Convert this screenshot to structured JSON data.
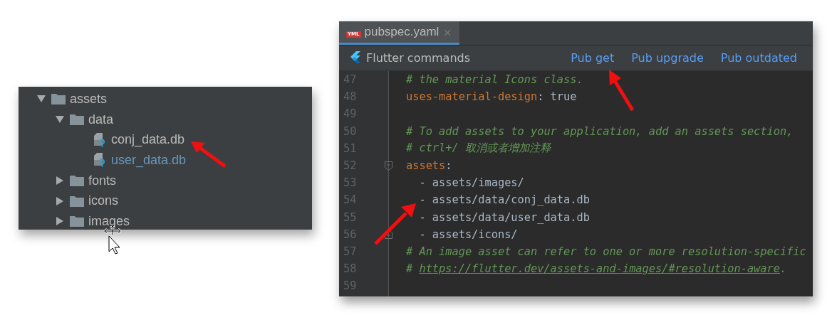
{
  "project_tree": [
    {
      "label": "assets",
      "kind": "folder",
      "expanded": true,
      "children": [
        {
          "label": "data",
          "kind": "folder",
          "expanded": true,
          "children": [
            {
              "label": "conj_data.db",
              "kind": "file",
              "color": "#bbbbbb"
            },
            {
              "label": "user_data.db",
              "kind": "file",
              "color": "#6897bb"
            }
          ]
        },
        {
          "label": "fonts",
          "kind": "folder",
          "expanded": false
        },
        {
          "label": "icons",
          "kind": "folder",
          "expanded": false
        },
        {
          "label": "images",
          "kind": "folder",
          "expanded": false
        }
      ]
    }
  ],
  "editor": {
    "tabs": [
      {
        "label": "pubspec.yaml",
        "icon_text": "YML",
        "close": "×",
        "selected": true
      }
    ],
    "commands_bar": {
      "title": "Flutter commands",
      "links": [
        "Pub get",
        "Pub upgrade",
        "Pub outdated"
      ]
    },
    "lines": [
      {
        "number": "47",
        "segments": [
          {
            "kind": "comment",
            "text": "# the material Icons class."
          }
        ]
      },
      {
        "number": "48",
        "segments": [
          {
            "kind": "key",
            "text": "uses-material-design"
          },
          {
            "kind": "plain",
            "text": ": true"
          }
        ]
      },
      {
        "number": "49"
      },
      {
        "number": "50",
        "segments": [
          {
            "kind": "comment",
            "text": "# To add assets to your application, add an assets section,"
          }
        ]
      },
      {
        "number": "51",
        "segments": [
          {
            "kind": "comment",
            "text": "# ctrl+/ 取消或者增加注释"
          }
        ]
      },
      {
        "number": "52",
        "fold_start": true,
        "segments": [
          {
            "kind": "key",
            "text": "assets"
          },
          {
            "kind": "plain",
            "text": ":"
          }
        ]
      },
      {
        "number": "53",
        "segments": [
          {
            "kind": "plain",
            "text": "  - assets/images/"
          }
        ]
      },
      {
        "number": "54",
        "segments": [
          {
            "kind": "plain",
            "text": "  - assets/data/conj_data.db"
          }
        ]
      },
      {
        "number": "55",
        "segments": [
          {
            "kind": "plain",
            "text": "  - assets/data/user_data.db"
          }
        ]
      },
      {
        "number": "56",
        "fold_end": true,
        "segments": [
          {
            "kind": "plain",
            "text": "  - assets/icons/"
          }
        ]
      },
      {
        "number": "57",
        "segments": [
          {
            "kind": "comment",
            "text": "# An image asset can refer to one or more resolution-specific"
          }
        ]
      },
      {
        "number": "58",
        "segments": [
          {
            "kind": "comment",
            "text": "# "
          },
          {
            "kind": "link",
            "text": "https://flutter.dev/assets-and-images/#resolution-aware"
          },
          {
            "kind": "comment",
            "text": "."
          }
        ]
      },
      {
        "number": "59"
      }
    ]
  }
}
